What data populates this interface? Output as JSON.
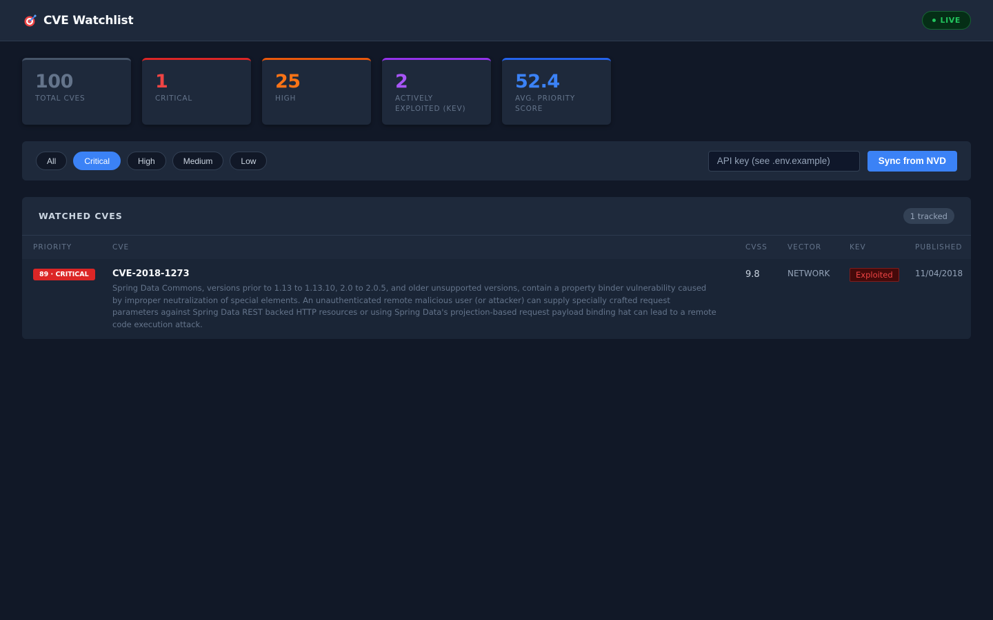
{
  "header": {
    "title": "CVE Watchlist",
    "icon": "target-icon",
    "live_label": "LIVE"
  },
  "stats": [
    {
      "value": "100",
      "label": "TOTAL CVES",
      "color": "#64748b"
    },
    {
      "value": "1",
      "label": "CRITICAL",
      "color": "#ef4444"
    },
    {
      "value": "25",
      "label": "HIGH",
      "color": "#f97316"
    },
    {
      "value": "2",
      "label": "ACTIVELY EXPLOITED (KEV)",
      "color": "#a855f7"
    },
    {
      "value": "52.4",
      "label": "AVG. PRIORITY SCORE",
      "color": "#3b82f6"
    }
  ],
  "filters": {
    "options": [
      "All",
      "Critical",
      "High",
      "Medium",
      "Low"
    ],
    "selected": "Critical",
    "api_key_placeholder": "API key (see .env.example)",
    "sync_label": "Sync from NVD"
  },
  "watchlist": {
    "title": "WATCHED CVES",
    "tracked_label": "1 tracked",
    "columns": [
      "PRIORITY",
      "CVE",
      "CVSS",
      "VECTOR",
      "KEV",
      "PUBLISHED"
    ],
    "rows": [
      {
        "priority": "89 · CRITICAL",
        "cve_id": "CVE-2018-1273",
        "description": "Spring Data Commons, versions prior to 1.13 to 1.13.10, 2.0 to 2.0.5, and older unsupported versions, contain a property binder vulnerability caused by improper neutralization of special elements. An unauthenticated remote malicious user (or attacker) can supply specially crafted request parameters against Spring Data REST backed HTTP resources or using Spring Data's projection-based request payload binding hat can lead to a remote code execution attack.",
        "cvss": "9.8",
        "vector": "NETWORK",
        "kev": "Exploited",
        "published": "11/04/2018"
      }
    ]
  },
  "colors": {
    "accent": "#3b82f6",
    "critical": "#dc2626",
    "live": "#22c55e",
    "background": "#111827",
    "surface": "#1e293b"
  }
}
